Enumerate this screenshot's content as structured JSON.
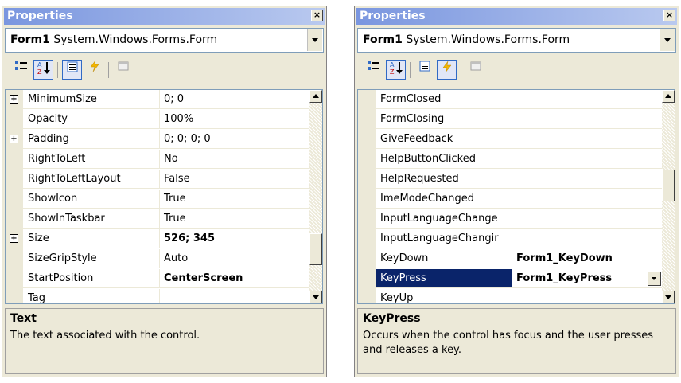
{
  "left": {
    "title": "Properties",
    "close_label": "×",
    "object": {
      "name": "Form1",
      "type": "System.Windows.Forms.Form"
    },
    "rows": [
      {
        "name": "MinimumSize",
        "value": "0; 0",
        "bold": false,
        "expandable": true
      },
      {
        "name": "Opacity",
        "value": "100%",
        "bold": false,
        "expandable": false
      },
      {
        "name": "Padding",
        "value": "0; 0; 0; 0",
        "bold": false,
        "expandable": true
      },
      {
        "name": "RightToLeft",
        "value": "No",
        "bold": false,
        "expandable": false
      },
      {
        "name": "RightToLeftLayout",
        "value": "False",
        "bold": false,
        "expandable": false
      },
      {
        "name": "ShowIcon",
        "value": "True",
        "bold": false,
        "expandable": false
      },
      {
        "name": "ShowInTaskbar",
        "value": "True",
        "bold": false,
        "expandable": false
      },
      {
        "name": "Size",
        "value": "526; 345",
        "bold": true,
        "expandable": true
      },
      {
        "name": "SizeGripStyle",
        "value": "Auto",
        "bold": false,
        "expandable": false
      },
      {
        "name": "StartPosition",
        "value": "CenterScreen",
        "bold": true,
        "expandable": false
      },
      {
        "name": "Tag",
        "value": "",
        "bold": false,
        "expandable": false
      }
    ],
    "description": {
      "title": "Text",
      "text": "The text associated with the control."
    }
  },
  "right": {
    "title": "Properties",
    "close_label": "×",
    "object": {
      "name": "Form1",
      "type": "System.Windows.Forms.Form"
    },
    "rows": [
      {
        "name": "FormClosed",
        "value": "",
        "bold": false
      },
      {
        "name": "FormClosing",
        "value": "",
        "bold": false
      },
      {
        "name": "GiveFeedback",
        "value": "",
        "bold": false
      },
      {
        "name": "HelpButtonClicked",
        "value": "",
        "bold": false
      },
      {
        "name": "HelpRequested",
        "value": "",
        "bold": false
      },
      {
        "name": "ImeModeChanged",
        "value": "",
        "bold": false
      },
      {
        "name": "InputLanguageChange",
        "value": "",
        "bold": false
      },
      {
        "name": "InputLanguageChangir",
        "value": "",
        "bold": false
      },
      {
        "name": "KeyDown",
        "value": "Form1_KeyDown",
        "bold": true
      },
      {
        "name": "KeyPress",
        "value": "Form1_KeyPress",
        "bold": true,
        "selected": true
      },
      {
        "name": "KeyUp",
        "value": "",
        "bold": false
      }
    ],
    "description": {
      "title": "KeyPress",
      "text": "Occurs when the control has focus and the user presses and releases a key."
    }
  },
  "icons": {
    "categorized": "categorized-icon",
    "alphabetical": "alphabetical-icon",
    "properties": "properties-icon",
    "events": "events-icon",
    "property-pages": "property-pages-icon"
  }
}
